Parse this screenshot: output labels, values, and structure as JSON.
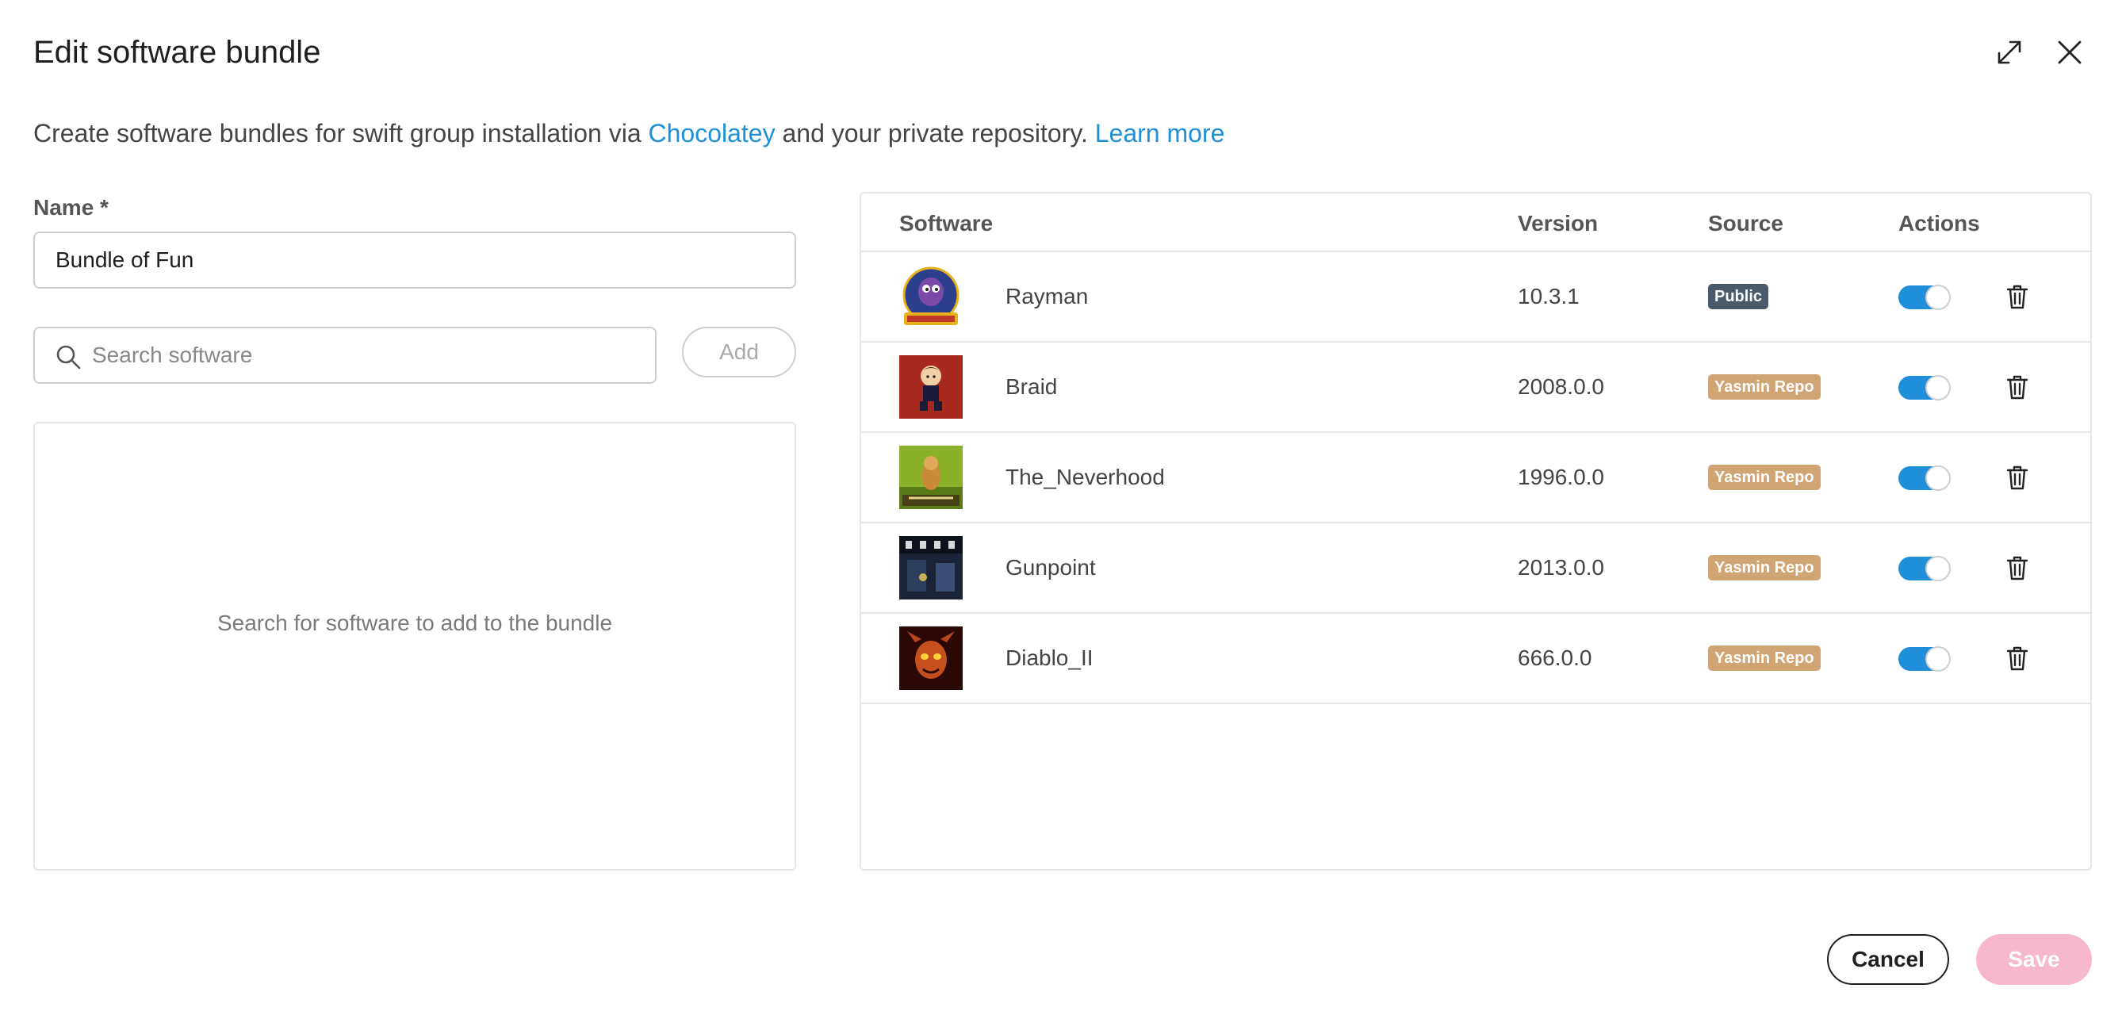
{
  "dialog": {
    "title": "Edit software bundle",
    "expand_icon": "expand-icon",
    "close_icon": "close-icon"
  },
  "description": {
    "text_before": "Create software bundles for swift group installation via ",
    "link_chocolatey": "Chocolatey",
    "text_middle": " and your private repository. ",
    "link_learn_more": "Learn more",
    "link_color": "#1f8fd9"
  },
  "form": {
    "name_label": "Name *",
    "name_value": "Bundle of Fun",
    "search_placeholder": "Search software",
    "search_icon": "search-icon",
    "add_label": "Add",
    "empty_message": "Search for software to add to the bundle"
  },
  "table": {
    "headers": [
      "Software",
      "Version",
      "Source",
      "Actions"
    ],
    "rows": [
      {
        "name": "Rayman",
        "version": "10.3.1",
        "source": "Public",
        "source_color": "#4a5a68",
        "enabled": true
      },
      {
        "name": "Braid",
        "version": "2008.0.0",
        "source": "Yasmin Repo",
        "source_color": "#d1a473",
        "enabled": true
      },
      {
        "name": "The_Neverhood",
        "version": "1996.0.0",
        "source": "Yasmin Repo",
        "source_color": "#d1a473",
        "enabled": true
      },
      {
        "name": "Gunpoint",
        "version": "2013.0.0",
        "source": "Yasmin Repo",
        "source_color": "#d1a473",
        "enabled": true
      },
      {
        "name": "Diablo_II",
        "version": "666.0.0",
        "source": "Yasmin Repo",
        "source_color": "#d1a473",
        "enabled": true
      }
    ],
    "toggle_color": "#1f8fd9",
    "delete_icon": "trash-icon"
  },
  "footer": {
    "cancel_label": "Cancel",
    "save_label": "Save",
    "save_color": "#f7b8cf"
  }
}
